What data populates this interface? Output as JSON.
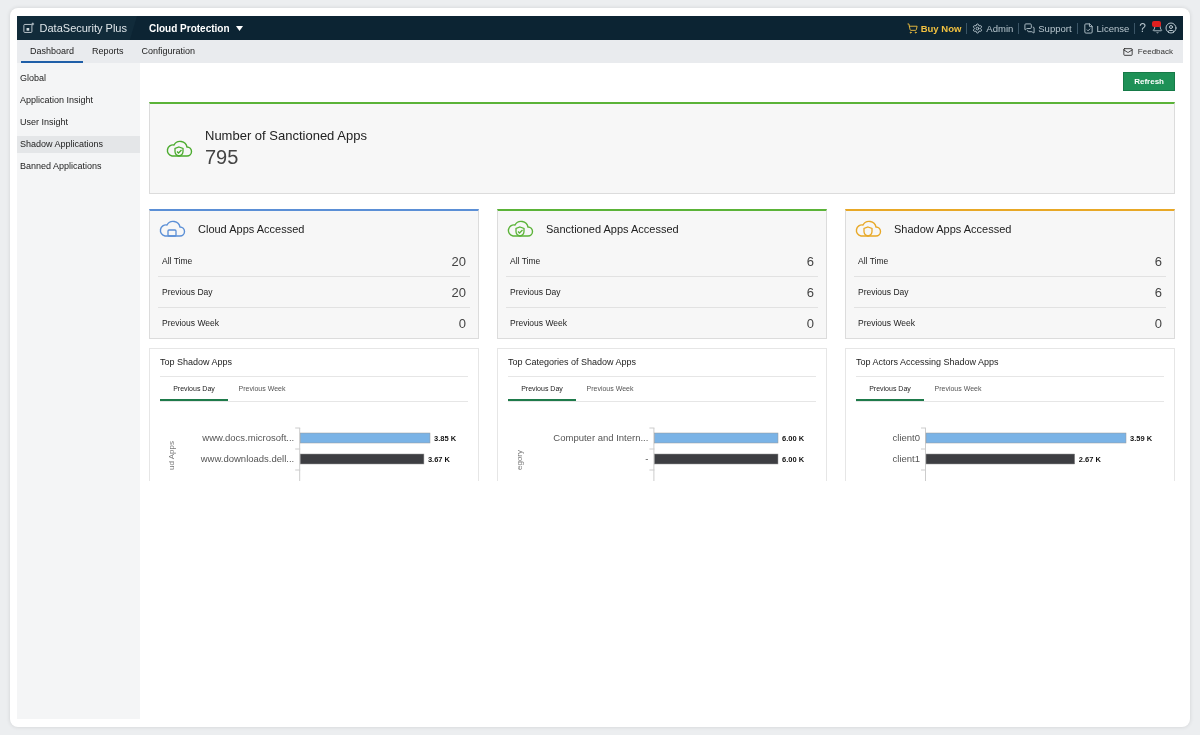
{
  "header": {
    "product": "DataSecurity Plus",
    "module": "Cloud Protection",
    "links": [
      {
        "label": "Buy Now",
        "kind": "buy"
      },
      {
        "label": "Admin",
        "kind": "admin"
      },
      {
        "label": "Support",
        "kind": "support"
      },
      {
        "label": "License",
        "kind": "license"
      }
    ],
    "help": "?"
  },
  "nav": {
    "tabs": [
      {
        "label": "Dashboard",
        "selected": true
      },
      {
        "label": "Reports",
        "selected": false
      },
      {
        "label": "Configuration",
        "selected": false
      }
    ],
    "feedback": "Feedback"
  },
  "sidebar": {
    "items": [
      {
        "label": "Global",
        "selected": false
      },
      {
        "label": "Application Insight",
        "selected": false
      },
      {
        "label": "User Insight",
        "selected": false
      },
      {
        "label": "Shadow Applications",
        "selected": true
      },
      {
        "label": "Banned Applications",
        "selected": false
      }
    ]
  },
  "refresh": "Refresh",
  "summary": {
    "title": "Number of Sanctioned Apps",
    "value": "795"
  },
  "stat_cards": [
    {
      "title": "Cloud Apps Accessed",
      "kind": "cloud",
      "color": "#5b8fd6",
      "rows": [
        {
          "label": "All Time",
          "value": "20"
        },
        {
          "label": "Previous Day",
          "value": "20"
        },
        {
          "label": "Previous Week",
          "value": "0"
        }
      ]
    },
    {
      "title": "Sanctioned Apps Accessed",
      "kind": "sanctioned",
      "color": "#5bb338",
      "rows": [
        {
          "label": "All Time",
          "value": "6"
        },
        {
          "label": "Previous Day",
          "value": "6"
        },
        {
          "label": "Previous Week",
          "value": "0"
        }
      ]
    },
    {
      "title": "Shadow Apps Accessed",
      "kind": "shadow",
      "color": "#e8a826",
      "rows": [
        {
          "label": "All Time",
          "value": "6"
        },
        {
          "label": "Previous Day",
          "value": "6"
        },
        {
          "label": "Previous Week",
          "value": "0"
        }
      ]
    }
  ],
  "charts": [
    {
      "title": "Top Shadow Apps",
      "tabs": [
        {
          "label": "Previous Day",
          "selected": true
        },
        {
          "label": "Previous Week",
          "selected": false
        }
      ],
      "chart_data": {
        "type": "bar",
        "orientation": "horizontal",
        "ylabel": "ud Apps",
        "categories": [
          "www.docs.microsoft...",
          "www.downloads.dell..."
        ],
        "values": [
          3850,
          3670
        ],
        "colors": [
          "#7ab3e6",
          "#3d3e42"
        ],
        "value_labels": [
          "3.85 K",
          "3.67 K"
        ]
      }
    },
    {
      "title": "Top Categories of Shadow Apps",
      "tabs": [
        {
          "label": "Previous Day",
          "selected": true
        },
        {
          "label": "Previous Week",
          "selected": false
        }
      ],
      "chart_data": {
        "type": "bar",
        "orientation": "horizontal",
        "ylabel": "egory",
        "categories": [
          "Computer and Intern...",
          "-"
        ],
        "values": [
          6000,
          6000
        ],
        "colors": [
          "#7ab3e6",
          "#3d3e42"
        ],
        "value_labels": [
          "6.00 K",
          "6.00 K"
        ]
      }
    },
    {
      "title": "Top Actors Accessing Shadow Apps",
      "tabs": [
        {
          "label": "Previous Day",
          "selected": true
        },
        {
          "label": "Previous Week",
          "selected": false
        }
      ],
      "chart_data": {
        "type": "bar",
        "orientation": "horizontal",
        "categories": [
          "client0",
          "client1"
        ],
        "values": [
          3590,
          2670
        ],
        "colors": [
          "#7ab3e6",
          "#3d3e42"
        ],
        "value_labels": [
          "3.59 K",
          "2.67 K"
        ]
      }
    }
  ]
}
